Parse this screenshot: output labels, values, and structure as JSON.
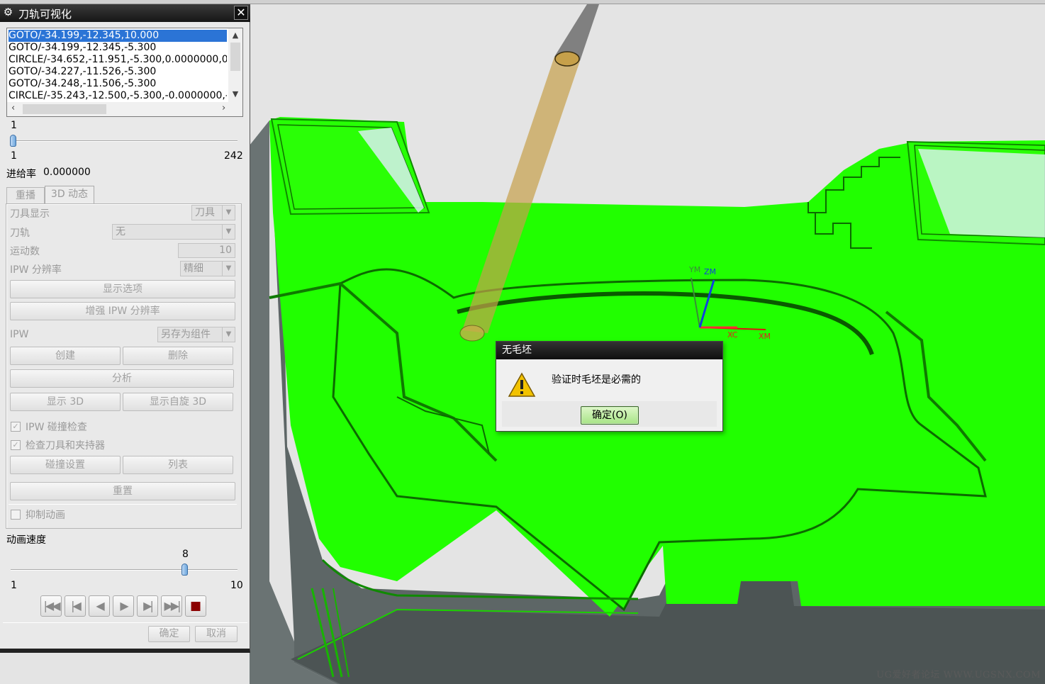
{
  "panel": {
    "title": "刀轨可视化",
    "list_rows": [
      "GOTO/-34.199,-12.345,10.000",
      "GOTO/-34.199,-12.345,-5.300",
      "CIRCLE/-34.652,-11.951,-5.300,0.0000000,0",
      "GOTO/-34.227,-11.526,-5.300",
      "GOTO/-34.248,-11.506,-5.300",
      "CIRCLE/-35.243,-12.500,-5.300,-0.0000000,-"
    ],
    "step_slider": {
      "value": "1",
      "min": "1",
      "max": "242",
      "position": 0.0
    },
    "feed_rate_label": "进给率",
    "feed_rate_value": "0.000000",
    "tabs": {
      "replay": "重播",
      "dynamic": "3D 动态"
    },
    "tool_display_label": "刀具显示",
    "tool_display_value": "刀具",
    "toolpath_label": "刀轨",
    "toolpath_value": "无",
    "motions_label": "运动数",
    "motions_value": "10",
    "ipw_resolution_label": "IPW 分辨率",
    "ipw_resolution_value": "精细",
    "display_options_btn": "显示选项",
    "enhance_ipw_btn": "增强 IPW 分辨率",
    "ipw_label": "IPW",
    "ipw_value": "另存为组件",
    "create_btn": "创建",
    "delete_btn": "删除",
    "analyze_btn": "分析",
    "show3d_btn": "显示 3D",
    "show_spin3d_btn": "显示自旋 3D",
    "ipw_collision_check": {
      "label": "IPW 碰撞检查",
      "checked": true
    },
    "check_tool_holder": {
      "label": "检查刀具和夹持器",
      "checked": true
    },
    "collision_settings_btn": "碰撞设置",
    "list_btn": "列表",
    "reset_btn": "重置",
    "suppress_animation": {
      "label": "抑制动画",
      "checked": false
    },
    "anim_speed_label": "动画速度",
    "speed_slider": {
      "value": "8",
      "min": "1",
      "max": "10",
      "position": 0.7778
    },
    "ok_btn": "确定",
    "cancel_btn": "取消"
  },
  "alert": {
    "title": "无毛坯",
    "message": "验证时毛坯是必需的",
    "ok_label": "确定(O)"
  },
  "triad": {
    "xc": "XC",
    "xm": "XM",
    "ym": "YM",
    "zm": "ZM"
  },
  "watermark": "UG爱好者论坛 WWW.UGSNX.COM",
  "colors": {
    "part": "#21ff00",
    "dialog_title": "#1a1a1a",
    "selection": "#2b74d6",
    "tool": "#c8a44a"
  }
}
